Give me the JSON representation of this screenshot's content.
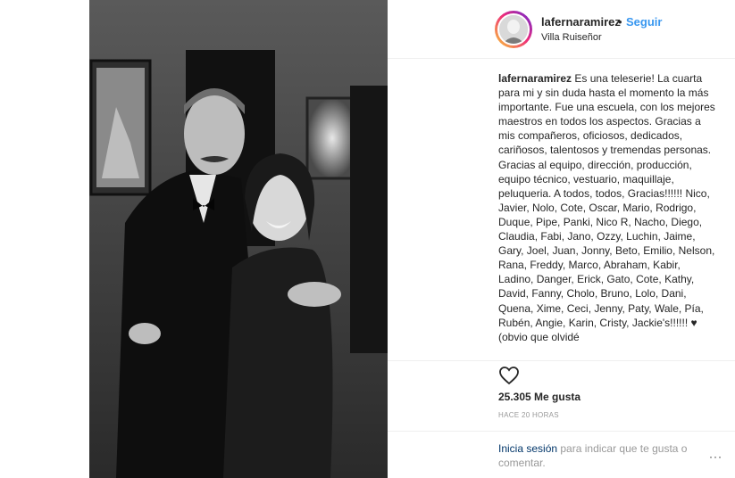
{
  "post": {
    "username": "lafernaramirez",
    "separator": "•",
    "follow_label": "Seguir",
    "location": "Villa Ruiseñor"
  },
  "caption": {
    "username": "lafernaramirez",
    "text": "Es una teleserie! La cuarta para mi y sin duda hasta el momento la más importante. Fue una escuela, con los mejores maestros en todos los aspectos. Gracias a mis compañeros, oficiosos, dedicados, cariñosos, talentosos y tremendas personas. Gracias al equipo, dirección, producción, equipo técnico, vestuario, maquillaje, peluqueria. A todos, todos, Gracias!!!!!! Nico, Javier, Nolo, Cote, Oscar, Mario, Rodrigo, Duque, Pipe, Panki, Nico R, Nacho, Diego, Claudia, Fabi, Jano, Ozzy, Luchin, Jaime, Gary, Joel, Juan, Jonny, Beto, Emilio, Nelson, Rana, Freddy, Marco, Abraham, Kabir, Ladino, Danger, Erick, Gato, Cote, Kathy, David, Fanny, Cholo, Bruno, Lolo, Dani, Quena, Xime, Ceci, Jenny, Paty, Wale, Pía, Rubén, Angie, Karin, Cristy, Jackie's!!!!!! ♥ (obvio que olvidé"
  },
  "actions": {
    "like_icon": "heart-outline-icon",
    "comment_icon": "comment-icon",
    "save_icon": "bookmark-icon"
  },
  "likes_text": "25.305 Me gusta",
  "timestamp": "HACE 20 HORAS",
  "footer": {
    "login_link": "Inicia sesión",
    "login_rest": " para indicar que te gusta o comentar.",
    "more_label": "···"
  },
  "colors": {
    "link_blue": "#3897f0",
    "login_blue": "#003569",
    "text": "#262626",
    "muted": "#999999"
  }
}
